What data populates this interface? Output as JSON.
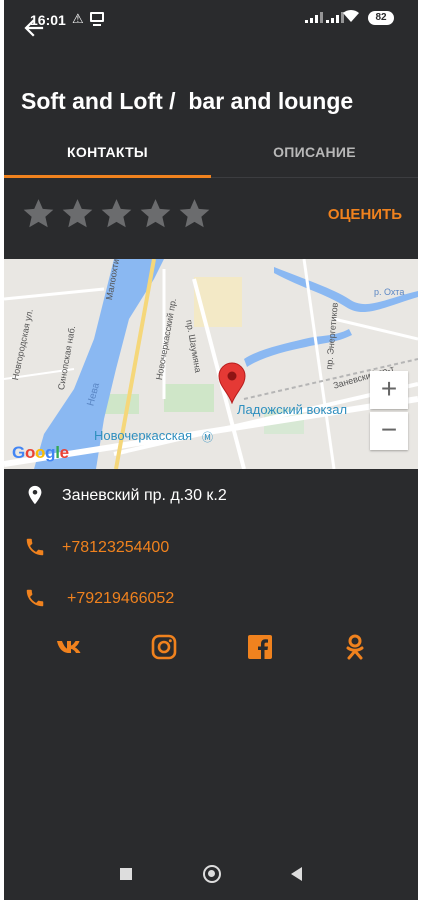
{
  "status_bar": {
    "time": "16:01",
    "battery": "82"
  },
  "header": {
    "title": "Soft and Loft /  bar and lounge"
  },
  "tabs": [
    {
      "label": "КОНТАКТЫ",
      "active": true
    },
    {
      "label": "ОПИСАНИЕ",
      "active": false
    }
  ],
  "rating": {
    "stars_filled": 0,
    "stars_total": 5,
    "rate_label": "ОЦЕНИТЬ"
  },
  "map": {
    "labels": {
      "station": "Ладожский вокзал",
      "metro": "Новочеркасская",
      "river": "Нева",
      "okhta": "р. Охта",
      "malookhtinsky": "Малоохтинская наб.",
      "sinopskaya": "Синопская наб.",
      "novgorodskaya": "Новгородская ул.",
      "energetikov": "пр. Энергетиков",
      "zanevsky": "Заневский пр-т",
      "shaumyana": "пр. Шаумяна",
      "novocherkassky": "Новочеркасский пр."
    },
    "zoom_in": "+",
    "zoom_out": "−",
    "logo": "Google"
  },
  "contacts": {
    "address": "Заневский пр. д.30 к.2",
    "phones": [
      "+78123254400",
      "+79219466052"
    ]
  },
  "social": [
    "vk-icon",
    "instagram-icon",
    "facebook-icon",
    "odnoklassniki-icon"
  ],
  "colors": {
    "accent": "#f0821e",
    "background": "#2a2b2d",
    "star_empty": "#6b6c6e"
  }
}
